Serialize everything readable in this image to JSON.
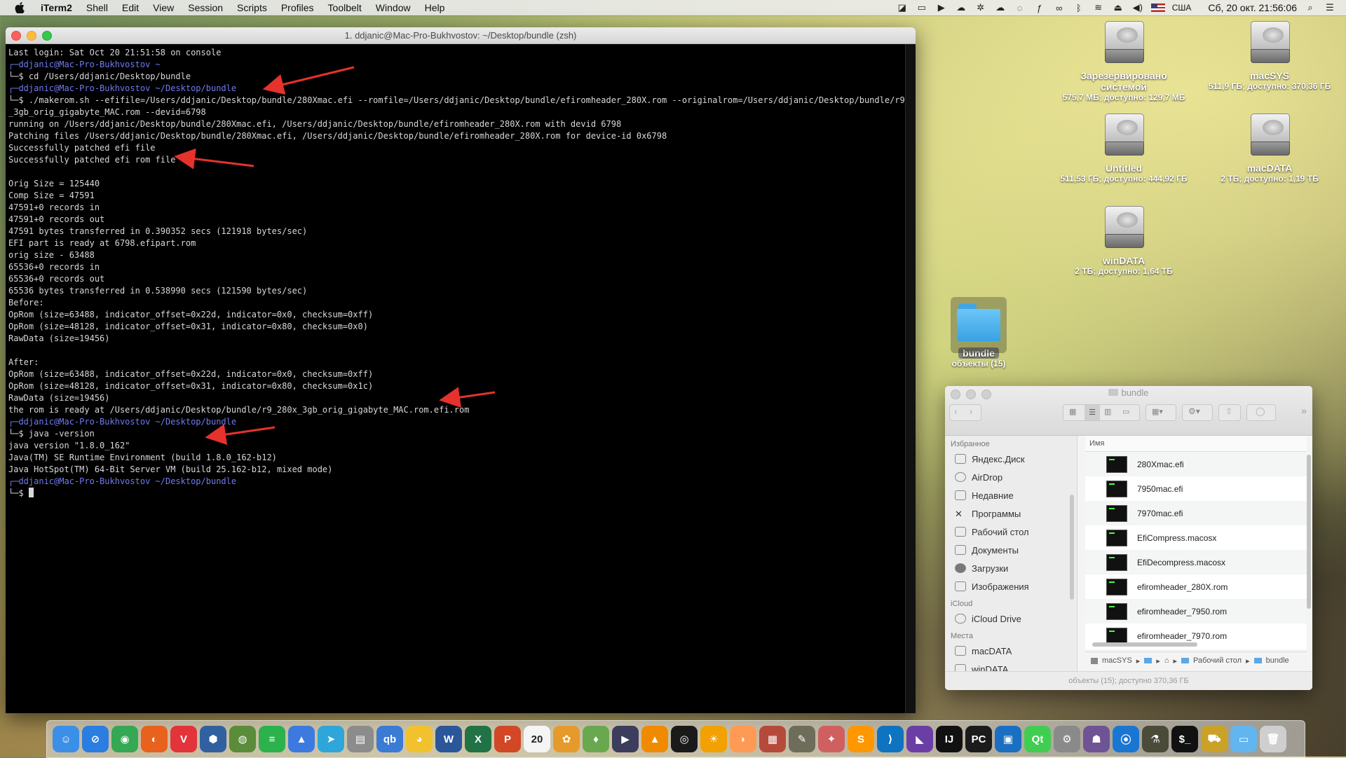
{
  "menubar": {
    "items": [
      "iTerm2",
      "Shell",
      "Edit",
      "View",
      "Session",
      "Scripts",
      "Profiles",
      "Toolbelt",
      "Window",
      "Help"
    ],
    "input_source": "США",
    "datetime": "Сб, 20 окт.  21:56:06"
  },
  "terminal": {
    "title": "1. ddjanic@Mac-Pro-Bukhvostov: ~/Desktop/bundle (zsh)",
    "lines": [
      {
        "t": "Last login: Sat Oct 20 21:51:58 on console",
        "p": false
      },
      {
        "t": "┌─ddjanic@Mac-Pro-Bukhvostov ~",
        "p": true
      },
      {
        "t": "└─$ cd /Users/ddjanic/Desktop/bundle",
        "p": false
      },
      {
        "t": "┌─ddjanic@Mac-Pro-Bukhvostov ~/Desktop/bundle",
        "p": true
      },
      {
        "t": "└─$ ./makerom.sh --efifile=/Users/ddjanic/Desktop/bundle/280Xmac.efi --romfile=/Users/ddjanic/Desktop/bundle/efiromheader_280X.rom --originalrom=/Users/ddjanic/Desktop/bundle/r9_280x",
        "p": false
      },
      {
        "t": "_3gb_orig_gigabyte_MAC.rom --devid=6798",
        "p": false
      },
      {
        "t": "running on /Users/ddjanic/Desktop/bundle/280Xmac.efi, /Users/ddjanic/Desktop/bundle/efiromheader_280X.rom with devid 6798",
        "p": false
      },
      {
        "t": "Patching files /Users/ddjanic/Desktop/bundle/280Xmac.efi, /Users/ddjanic/Desktop/bundle/efiromheader_280X.rom for device-id 0x6798",
        "p": false
      },
      {
        "t": "Successfully patched efi file",
        "p": false
      },
      {
        "t": "Successfully patched efi rom file",
        "p": false
      },
      {
        "t": "",
        "p": false
      },
      {
        "t": "Orig Size = 125440",
        "p": false
      },
      {
        "t": "Comp Size = 47591",
        "p": false
      },
      {
        "t": "47591+0 records in",
        "p": false
      },
      {
        "t": "47591+0 records out",
        "p": false
      },
      {
        "t": "47591 bytes transferred in 0.390352 secs (121918 bytes/sec)",
        "p": false
      },
      {
        "t": "EFI part is ready at 6798.efipart.rom",
        "p": false
      },
      {
        "t": "orig size - 63488",
        "p": false
      },
      {
        "t": "65536+0 records in",
        "p": false
      },
      {
        "t": "65536+0 records out",
        "p": false
      },
      {
        "t": "65536 bytes transferred in 0.538990 secs (121590 bytes/sec)",
        "p": false
      },
      {
        "t": "Before:",
        "p": false
      },
      {
        "t": "OpRom (size=63488, indicator_offset=0x22d, indicator=0x0, checksum=0xff)",
        "p": false
      },
      {
        "t": "OpRom (size=48128, indicator_offset=0x31, indicator=0x80, checksum=0x0)",
        "p": false
      },
      {
        "t": "RawData (size=19456)",
        "p": false
      },
      {
        "t": "",
        "p": false
      },
      {
        "t": "After:",
        "p": false
      },
      {
        "t": "OpRom (size=63488, indicator_offset=0x22d, indicator=0x0, checksum=0xff)",
        "p": false
      },
      {
        "t": "OpRom (size=48128, indicator_offset=0x31, indicator=0x80, checksum=0x1c)",
        "p": false
      },
      {
        "t": "RawData (size=19456)",
        "p": false
      },
      {
        "t": "the rom is ready at /Users/ddjanic/Desktop/bundle/r9_280x_3gb_orig_gigabyte_MAC.rom.efi.rom",
        "p": false
      },
      {
        "t": "┌─ddjanic@Mac-Pro-Bukhvostov ~/Desktop/bundle",
        "p": true
      },
      {
        "t": "└─$ java -version",
        "p": false
      },
      {
        "t": "java version \"1.8.0_162\"",
        "p": false
      },
      {
        "t": "Java(TM) SE Runtime Environment (build 1.8.0_162-b12)",
        "p": false
      },
      {
        "t": "Java HotSpot(TM) 64-Bit Server VM (build 25.162-b12, mixed mode)",
        "p": false
      },
      {
        "t": "┌─ddjanic@Mac-Pro-Bukhvostov ~/Desktop/bundle",
        "p": true
      },
      {
        "t": "└─$ ",
        "p": false
      }
    ]
  },
  "desktop": {
    "icons": [
      {
        "name": "Зарезервировано системой",
        "sub": "575,7 МБ; доступно: 129,7 МБ"
      },
      {
        "name": "macSYS",
        "sub": "511,9 ГБ; доступно: 370,36 ГБ"
      },
      {
        "name": "Untitled",
        "sub": "511,53 ГБ; доступно: 444,92 ГБ"
      },
      {
        "name": "macDATA",
        "sub": "2 ТБ; доступно: 1,19 ТБ"
      },
      {
        "name": "winDATA",
        "sub": "2 ТБ; доступно: 1,64 ТБ"
      }
    ],
    "folder": {
      "name": "bundle",
      "sub": "объекты (15)"
    }
  },
  "finder": {
    "title": "bundle",
    "sidebar": {
      "favorites_header": "Избранное",
      "favorites": [
        "Яндекс.Диск",
        "AirDrop",
        "Недавние",
        "Программы",
        "Рабочий стол",
        "Документы",
        "Загрузки",
        "Изображения"
      ],
      "icloud_header": "iCloud",
      "icloud": [
        "iCloud Drive"
      ],
      "places_header": "Места",
      "places": [
        "macDATA",
        "winDATA"
      ]
    },
    "column_name": "Имя",
    "files": [
      "280Xmac.efi",
      "7950mac.efi",
      "7970mac.efi",
      "EfiCompress.macosx",
      "EfiDecompress.macosx",
      "efiromheader_280X.rom",
      "efiromheader_7950.rom",
      "efiromheader_7970.rom"
    ],
    "path": [
      "macSYS",
      "▸",
      "▸",
      "Рабочий стол",
      "▸",
      "bundle"
    ],
    "status": "объекты (15); доступно 370,36 ГБ"
  },
  "dock": {
    "apps": [
      {
        "name": "finder",
        "color": "#3b8fe6",
        "glyph": "☺"
      },
      {
        "name": "safari",
        "color": "#2a7de1",
        "glyph": "⊘"
      },
      {
        "name": "chrome",
        "color": "#34a853",
        "glyph": "◉"
      },
      {
        "name": "firefox",
        "color": "#e8621d",
        "glyph": "◐"
      },
      {
        "name": "vivaldi",
        "color": "#e3333b",
        "glyph": "V"
      },
      {
        "name": "settings-app",
        "color": "#3060a0",
        "glyph": "⬢"
      },
      {
        "name": "globe-app",
        "color": "#5a8c3a",
        "glyph": "◍"
      },
      {
        "name": "feedly",
        "color": "#2bb24c",
        "glyph": "≡"
      },
      {
        "name": "testflight",
        "color": "#3d7ae0",
        "glyph": "▲"
      },
      {
        "name": "telegram",
        "color": "#2ea6da",
        "glyph": "➤"
      },
      {
        "name": "archive-utility",
        "color": "#8c8c8c",
        "glyph": "▤"
      },
      {
        "name": "qbittorrent",
        "color": "#3a7bd5",
        "glyph": "qb"
      },
      {
        "name": "cyberduck",
        "color": "#f2c12e",
        "glyph": "◕"
      },
      {
        "name": "word",
        "color": "#2b579a",
        "glyph": "W"
      },
      {
        "name": "excel",
        "color": "#217346",
        "glyph": "X"
      },
      {
        "name": "powerpoint",
        "color": "#d24726",
        "glyph": "P"
      },
      {
        "name": "calendar",
        "color": "#f5f5f5",
        "glyph": "20"
      },
      {
        "name": "fruit-app",
        "color": "#e59a2b",
        "glyph": "✿"
      },
      {
        "name": "balloon-app",
        "color": "#6aa84f",
        "glyph": "♦"
      },
      {
        "name": "media-player",
        "color": "#3c3c5c",
        "glyph": "▶"
      },
      {
        "name": "vlc",
        "color": "#f08a00",
        "glyph": "▲"
      },
      {
        "name": "audio-app",
        "color": "#1a1a1a",
        "glyph": "◎"
      },
      {
        "name": "sun-app",
        "color": "#f2a100",
        "glyph": "☀"
      },
      {
        "name": "shell-app",
        "color": "#ff9a55",
        "glyph": "◗"
      },
      {
        "name": "presentation-app",
        "color": "#b64a3a",
        "glyph": "▦"
      },
      {
        "name": "gimp",
        "color": "#6d6d5a",
        "glyph": "✎"
      },
      {
        "name": "paint-app",
        "color": "#d06060",
        "glyph": "✦"
      },
      {
        "name": "sublime-text",
        "color": "#ff9800",
        "glyph": "S"
      },
      {
        "name": "vscode",
        "color": "#0e73c1",
        "glyph": "⟩"
      },
      {
        "name": "visual-studio",
        "color": "#6b3ea6",
        "glyph": "◣"
      },
      {
        "name": "intellij",
        "color": "#111111",
        "glyph": "IJ"
      },
      {
        "name": "pycharm",
        "color": "#1b1b1b",
        "glyph": "PC"
      },
      {
        "name": "virtualbox",
        "color": "#1b6fc2",
        "glyph": "▣"
      },
      {
        "name": "qt-creator",
        "color": "#41cd52",
        "glyph": "Qt"
      },
      {
        "name": "system-prefs",
        "color": "#8a8a8a",
        "glyph": "⚙"
      },
      {
        "name": "github-desktop",
        "color": "#6e5494",
        "glyph": "☗"
      },
      {
        "name": "maps-app",
        "color": "#1976d2",
        "glyph": "⦿"
      },
      {
        "name": "pod-app",
        "color": "#4b4b3a",
        "glyph": "⚗"
      },
      {
        "name": "iterm2",
        "color": "#111111",
        "glyph": "$_"
      },
      {
        "name": "installer-app",
        "color": "#c9a227",
        "glyph": "⛟"
      },
      {
        "name": "downloads-folder",
        "color": "#62b5ef",
        "glyph": "▭"
      },
      {
        "name": "trash",
        "color": "#cfcfcf",
        "glyph": "🗑"
      }
    ]
  }
}
